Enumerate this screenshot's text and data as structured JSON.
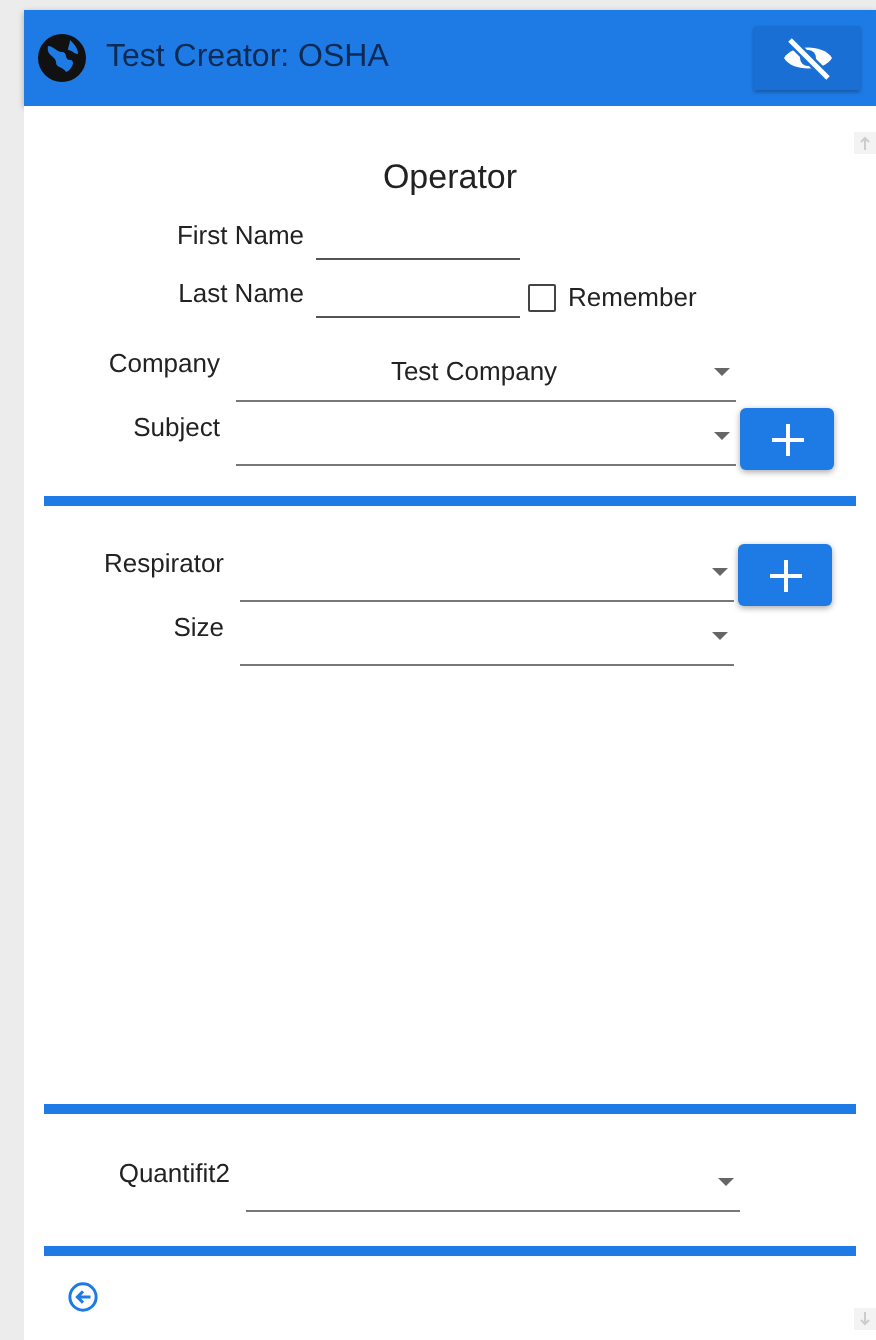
{
  "header": {
    "title": "Test Creator: OSHA"
  },
  "operator": {
    "heading": "Operator",
    "fields": [
      {
        "label": "First Name"
      },
      {
        "label": "Last Name"
      }
    ],
    "remember": {
      "label": "Remember",
      "checked": false
    }
  },
  "operator_selects": [
    {
      "label": "Company",
      "value": "Test Company",
      "add_button": false
    },
    {
      "label": "Subject",
      "add_button": true
    }
  ],
  "respirator_selects": [
    {
      "label": "Respirator",
      "add_button": true
    },
    {
      "label": "Size",
      "add_button": false
    }
  ],
  "device_select": {
    "label": "Quantifit2"
  }
}
